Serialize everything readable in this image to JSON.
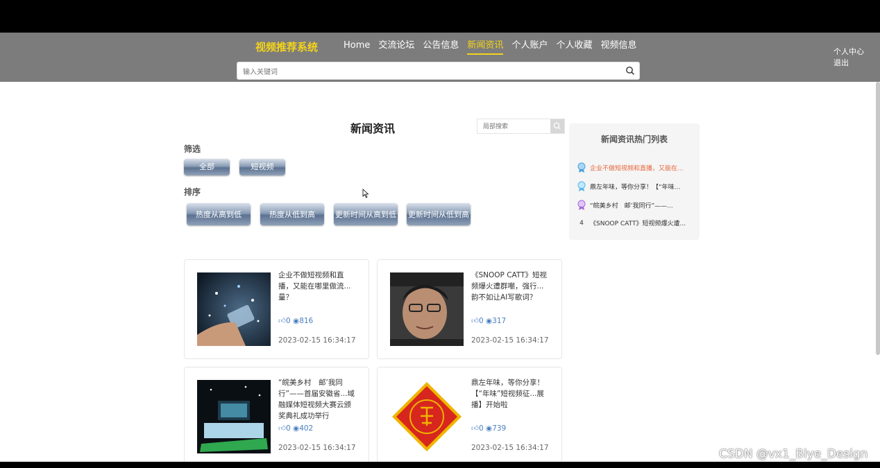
{
  "header": {
    "brand": "视频推荐系统",
    "nav": [
      "Home",
      "交流论坛",
      "公告信息",
      "新闻资讯",
      "个人账户",
      "个人收藏",
      "视频信息"
    ],
    "active_nav": "新闻资讯",
    "user_center": "个人中心",
    "logout": "退出",
    "search_placeholder": "输入关键词"
  },
  "main": {
    "title": "新闻资讯",
    "local_search_placeholder": "局部搜索",
    "filter_label": "筛选",
    "filter_buttons": [
      "全部",
      "短视频"
    ],
    "sort_label": "排序",
    "sort_buttons": [
      "热度从高到低",
      "热度从低到高",
      "更新时间从高到低",
      "更新时间从低到高"
    ],
    "cards": [
      {
        "title": "企业不做短视频和直播，又能在哪里做流...量？",
        "likes": "0",
        "views": "816",
        "time": "2023-02-15 16:34:17"
      },
      {
        "title": "《SNOOP CATT》短视频爆火遭群嘲，强行...韵不如让AI写歌词？",
        "likes": "0",
        "views": "317",
        "time": "2023-02-15 16:34:17"
      },
      {
        "title": "“皖美乡村　邮’我同行”——首届安徽省...域融媒体短视频大赛云颁奖典礼成功举行",
        "likes": "0",
        "views": "402",
        "time": "2023-02-15 16:34:17"
      },
      {
        "title": "鼎左年味，等你分享！【“年味”短视频征...展播】开始啦",
        "likes": "0",
        "views": "739",
        "time": "2023-02-15 16:34:17"
      }
    ]
  },
  "hot": {
    "title": "新闻资讯热门列表",
    "items": [
      {
        "rank": "1",
        "text": "企业不做短视频和直播，又能在..."
      },
      {
        "rank": "2",
        "text": "鼎左年味，等你分享！【“年味..."
      },
      {
        "rank": "3",
        "text": "“皖美乡村　邮’我同行”——..."
      },
      {
        "rank": "4",
        "text": "《SNOOP CATT》短视频爆火遭..."
      }
    ]
  },
  "watermark": "CSDN @vx1_Biye_Design",
  "colors": {
    "accent": "#f4d31a",
    "header_bg": "#7c7c7c",
    "link": "#4a7fc0",
    "hot_first": "#e8663d"
  }
}
